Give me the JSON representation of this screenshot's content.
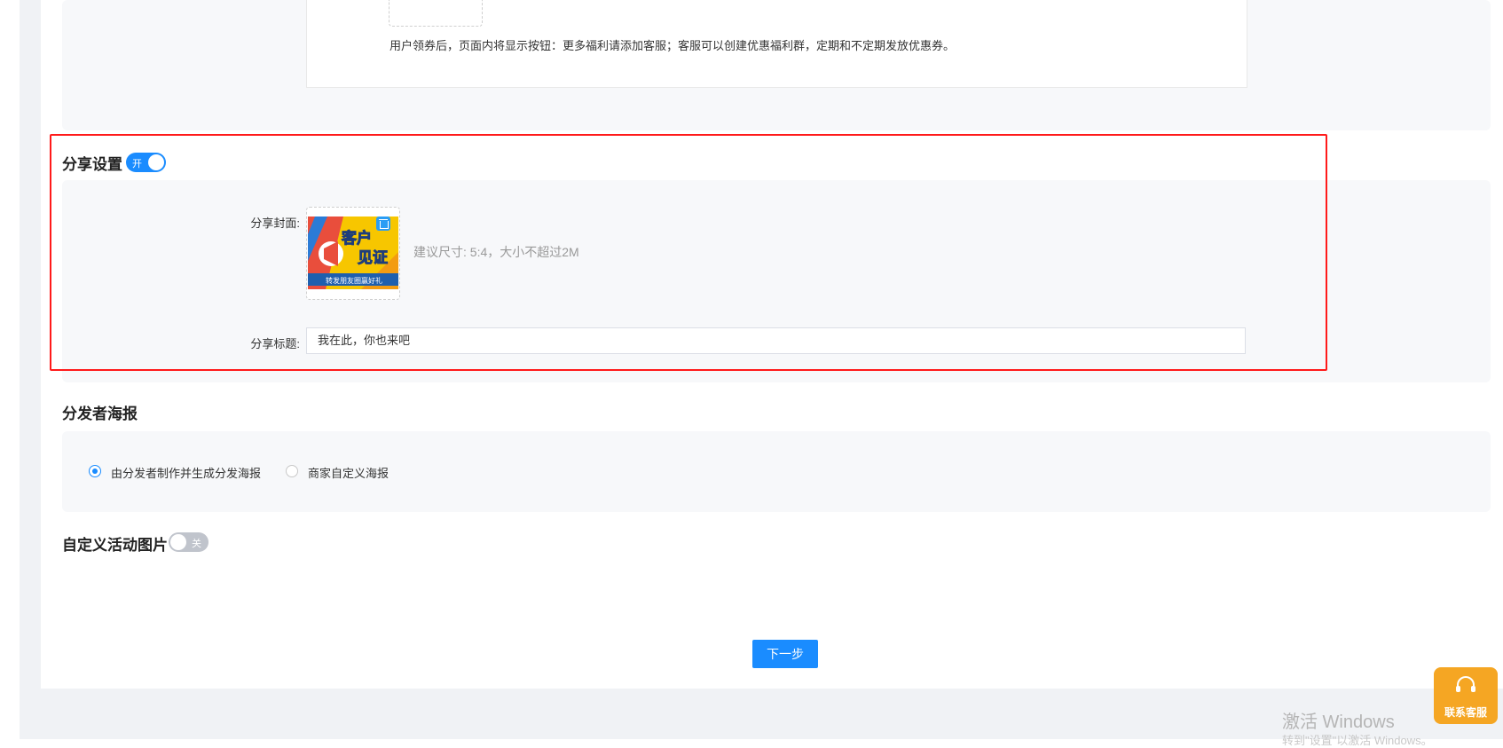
{
  "coupon_panel": {
    "tip": "用户领券后，页面内将显示按钮：更多福利请添加客服；客服可以创建优惠福利群，定期和不定期发放优惠券。"
  },
  "share_settings": {
    "title": "分享设置",
    "switch_label": "开",
    "switch_on": true,
    "cover_label": "分享封面:",
    "cover_image": {
      "headline_line1": "客户",
      "headline_line2": "见证",
      "caption": "转发朋友圈赢好礼"
    },
    "cover_hint": "建议尺寸: 5:4，大小不超过2M",
    "title_label": "分享标题:",
    "title_value": "我在此，你也来吧"
  },
  "distributor_poster": {
    "title": "分发者海报",
    "options": [
      {
        "label": "由分发者制作并生成分发海报",
        "checked": true
      },
      {
        "label": "商家自定义海报",
        "checked": false
      }
    ]
  },
  "custom_image": {
    "title": "自定义活动图片",
    "switch_label": "关",
    "switch_on": false
  },
  "next_button": "下一步",
  "watermark": {
    "line1": "激活 Windows",
    "line2": "转到\"设置\"以激活 Windows。"
  },
  "support_button": "联系客服",
  "colors": {
    "primary": "#1a8cff",
    "highlight_frame": "#ff1a1a",
    "support": "#f5a623"
  }
}
